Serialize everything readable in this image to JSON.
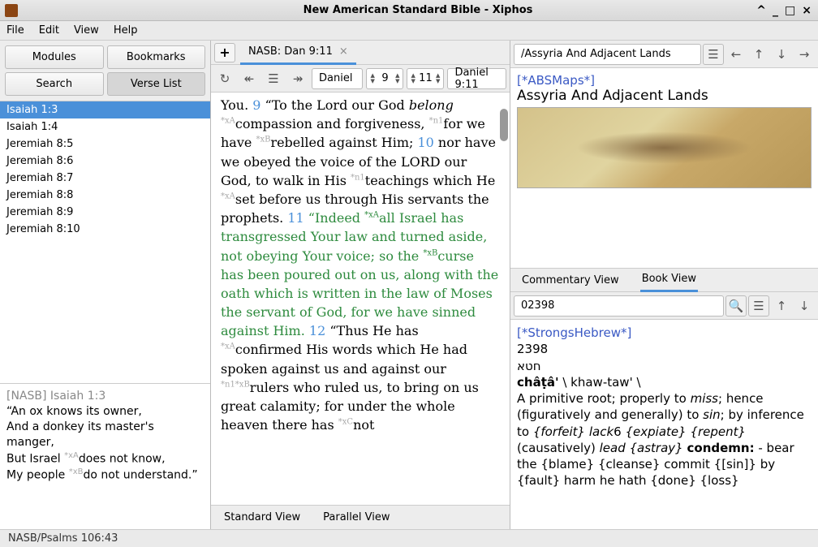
{
  "window": {
    "title": "New American Standard Bible - Xiphos"
  },
  "menubar": [
    "File",
    "Edit",
    "View",
    "Help"
  ],
  "left": {
    "buttons": {
      "modules": "Modules",
      "bookmarks": "Bookmarks",
      "search": "Search",
      "verselist": "Verse List"
    },
    "verses": [
      "Isaiah 1:3",
      "Isaiah 1:4",
      "Jeremiah 8:5",
      "Jeremiah 8:6",
      "Jeremiah 8:7",
      "Jeremiah 8:8",
      "Jeremiah 8:9",
      "Jeremiah 8:10"
    ],
    "selected_index": 0,
    "preview": {
      "ref": "[NASB] Isaiah 1:3",
      "line1": "“An ox knows its owner,",
      "line2": "And a donkey its master's manger,",
      "line3a": "But Israel ",
      "sup1": "*xA",
      "line3b": "does not know,",
      "line4a": "My people ",
      "sup2": "*xB",
      "line4b": "do not understand.”"
    }
  },
  "center": {
    "tab_label": "NASB: Dan 9:11",
    "book": "Daniel",
    "chapter": "9",
    "verse": "11",
    "location": "Daniel 9:11",
    "view_tabs": {
      "standard": "Standard View",
      "parallel": "Parallel View"
    },
    "text": {
      "p1a": "You.  ",
      "v9": "9",
      "p1b": " “To the Lord our God ",
      "p1c_it": "belong",
      "p1_sup1": " *xA",
      "p1d": "compassion and forgiveness, ",
      "p1_sup2": "*n1",
      "p1e": "for we have ",
      "p1_sup3": "*xB",
      "p1f": "rebelled against Him;  ",
      "v10": "10",
      "p1g": " nor have we obeyed the voice of the L",
      "ord": "ORD",
      "p1h": " our God, to walk in His ",
      "p1_sup4": "*n1",
      "p1i": "teachings which He ",
      "p1_sup5": "*xA",
      "p1j": "set before us through His servants the prophets.  ",
      "v11": "11",
      "p1k": " “Indeed ",
      "p1_sup6": "*xA",
      "green_a": "all Israel has transgressed Your law and turned aside, not obeying Your voice; so the ",
      "p1_sup7": "*xB",
      "green_b": "curse has been poured out on us, along with the oath which is written in the law of Moses the servant of God, for we have sinned against Him.",
      "v12": "12",
      "p1l": " “Thus He has ",
      "p1_sup8": "*xA",
      "p1m": "confirmed His words which He had spoken against us and against our ",
      "p1_sup9": "*n1*xB",
      "p1n": "rulers who ruled us, to bring on us great calamity; for under the whole heaven there has ",
      "p1_sup10": "*xC",
      "p1o": "not"
    }
  },
  "right": {
    "upper_path": "/Assyria And Adjacent Lands",
    "mod_label": "[*ABSMaps*]",
    "map_title": "Assyria And Adjacent Lands",
    "mid_tabs": {
      "commentary": "Commentary View",
      "book": "Book View"
    },
    "dict_query": "02398",
    "dict": {
      "mod_label": "[*StrongsHebrew*]",
      "num": "2398",
      "hebrew": "חטא",
      "translit_bold": "châṭâ'",
      "translit_rest": " \\ khaw-taw' \\",
      "def1": "A primitive root; properly to ",
      "def_it1": "miss",
      "def2": "; hence (figuratively and generally) to ",
      "def_it2": "sin",
      "def3": "; by inference to ",
      "def_it3": "{forfeit} lack",
      "def4": "6 ",
      "def_it4": "{expiate} {repent}",
      "def5": " (causatively) ",
      "def_it5": "lead {astray}",
      "def6": "  ",
      "def_bold": "condemn:",
      "def7": " - bear the {blame} {cleanse} commit {[sin]} by {fault} harm he hath {done} {loss}"
    }
  },
  "status": "NASB/Psalms 106:43"
}
